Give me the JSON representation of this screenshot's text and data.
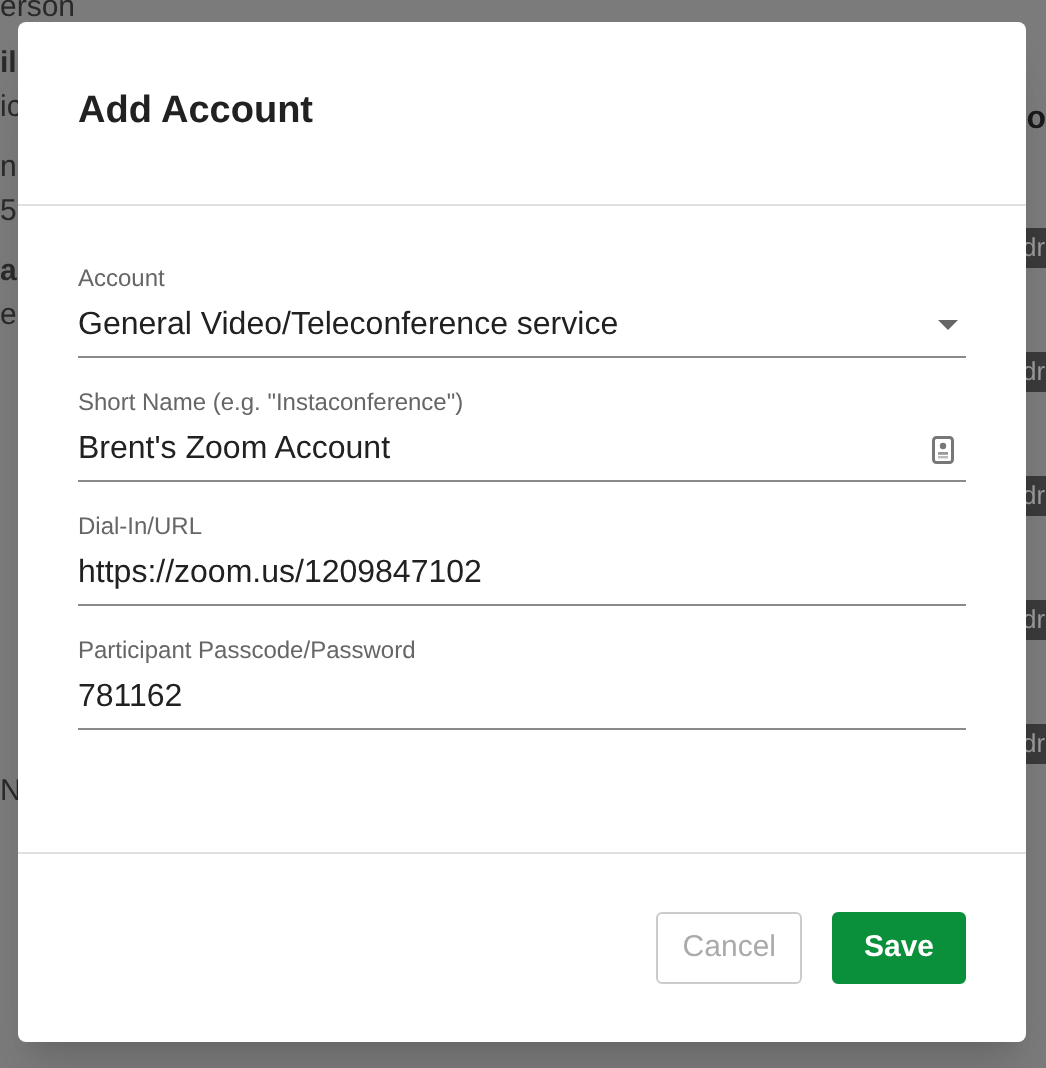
{
  "background": {
    "left_fragments": [
      {
        "text": "erson",
        "bold": false
      },
      {
        "text": "il",
        "bold": true
      },
      {
        "text": "ic",
        "bold": false
      },
      {
        "text": "n",
        "bold": false
      },
      {
        "text": "5",
        "bold": false
      },
      {
        "text": "a",
        "bold": true
      },
      {
        "text": "e",
        "bold": false
      },
      {
        "text": "N",
        "bold": false
      }
    ],
    "right_heading": "o",
    "right_tags": [
      "dr",
      "dr",
      "dr",
      "dr",
      "dr"
    ]
  },
  "dialog": {
    "title": "Add Account",
    "fields": [
      {
        "kind": "select",
        "label": "Account",
        "value": "General Video/Teleconference service"
      },
      {
        "kind": "contact",
        "label": "Short Name (e.g. \"Instaconference\")",
        "value": "Brent's Zoom Account"
      },
      {
        "kind": "text",
        "label": "Dial-In/URL",
        "value": "https://zoom.us/1209847102"
      },
      {
        "kind": "text",
        "label": "Participant Passcode/Password",
        "value": "781162"
      }
    ],
    "buttons": [
      {
        "label": "Cancel",
        "kind": "secondary",
        "disabled": true
      },
      {
        "label": "Save",
        "kind": "primary",
        "disabled": false
      }
    ]
  }
}
